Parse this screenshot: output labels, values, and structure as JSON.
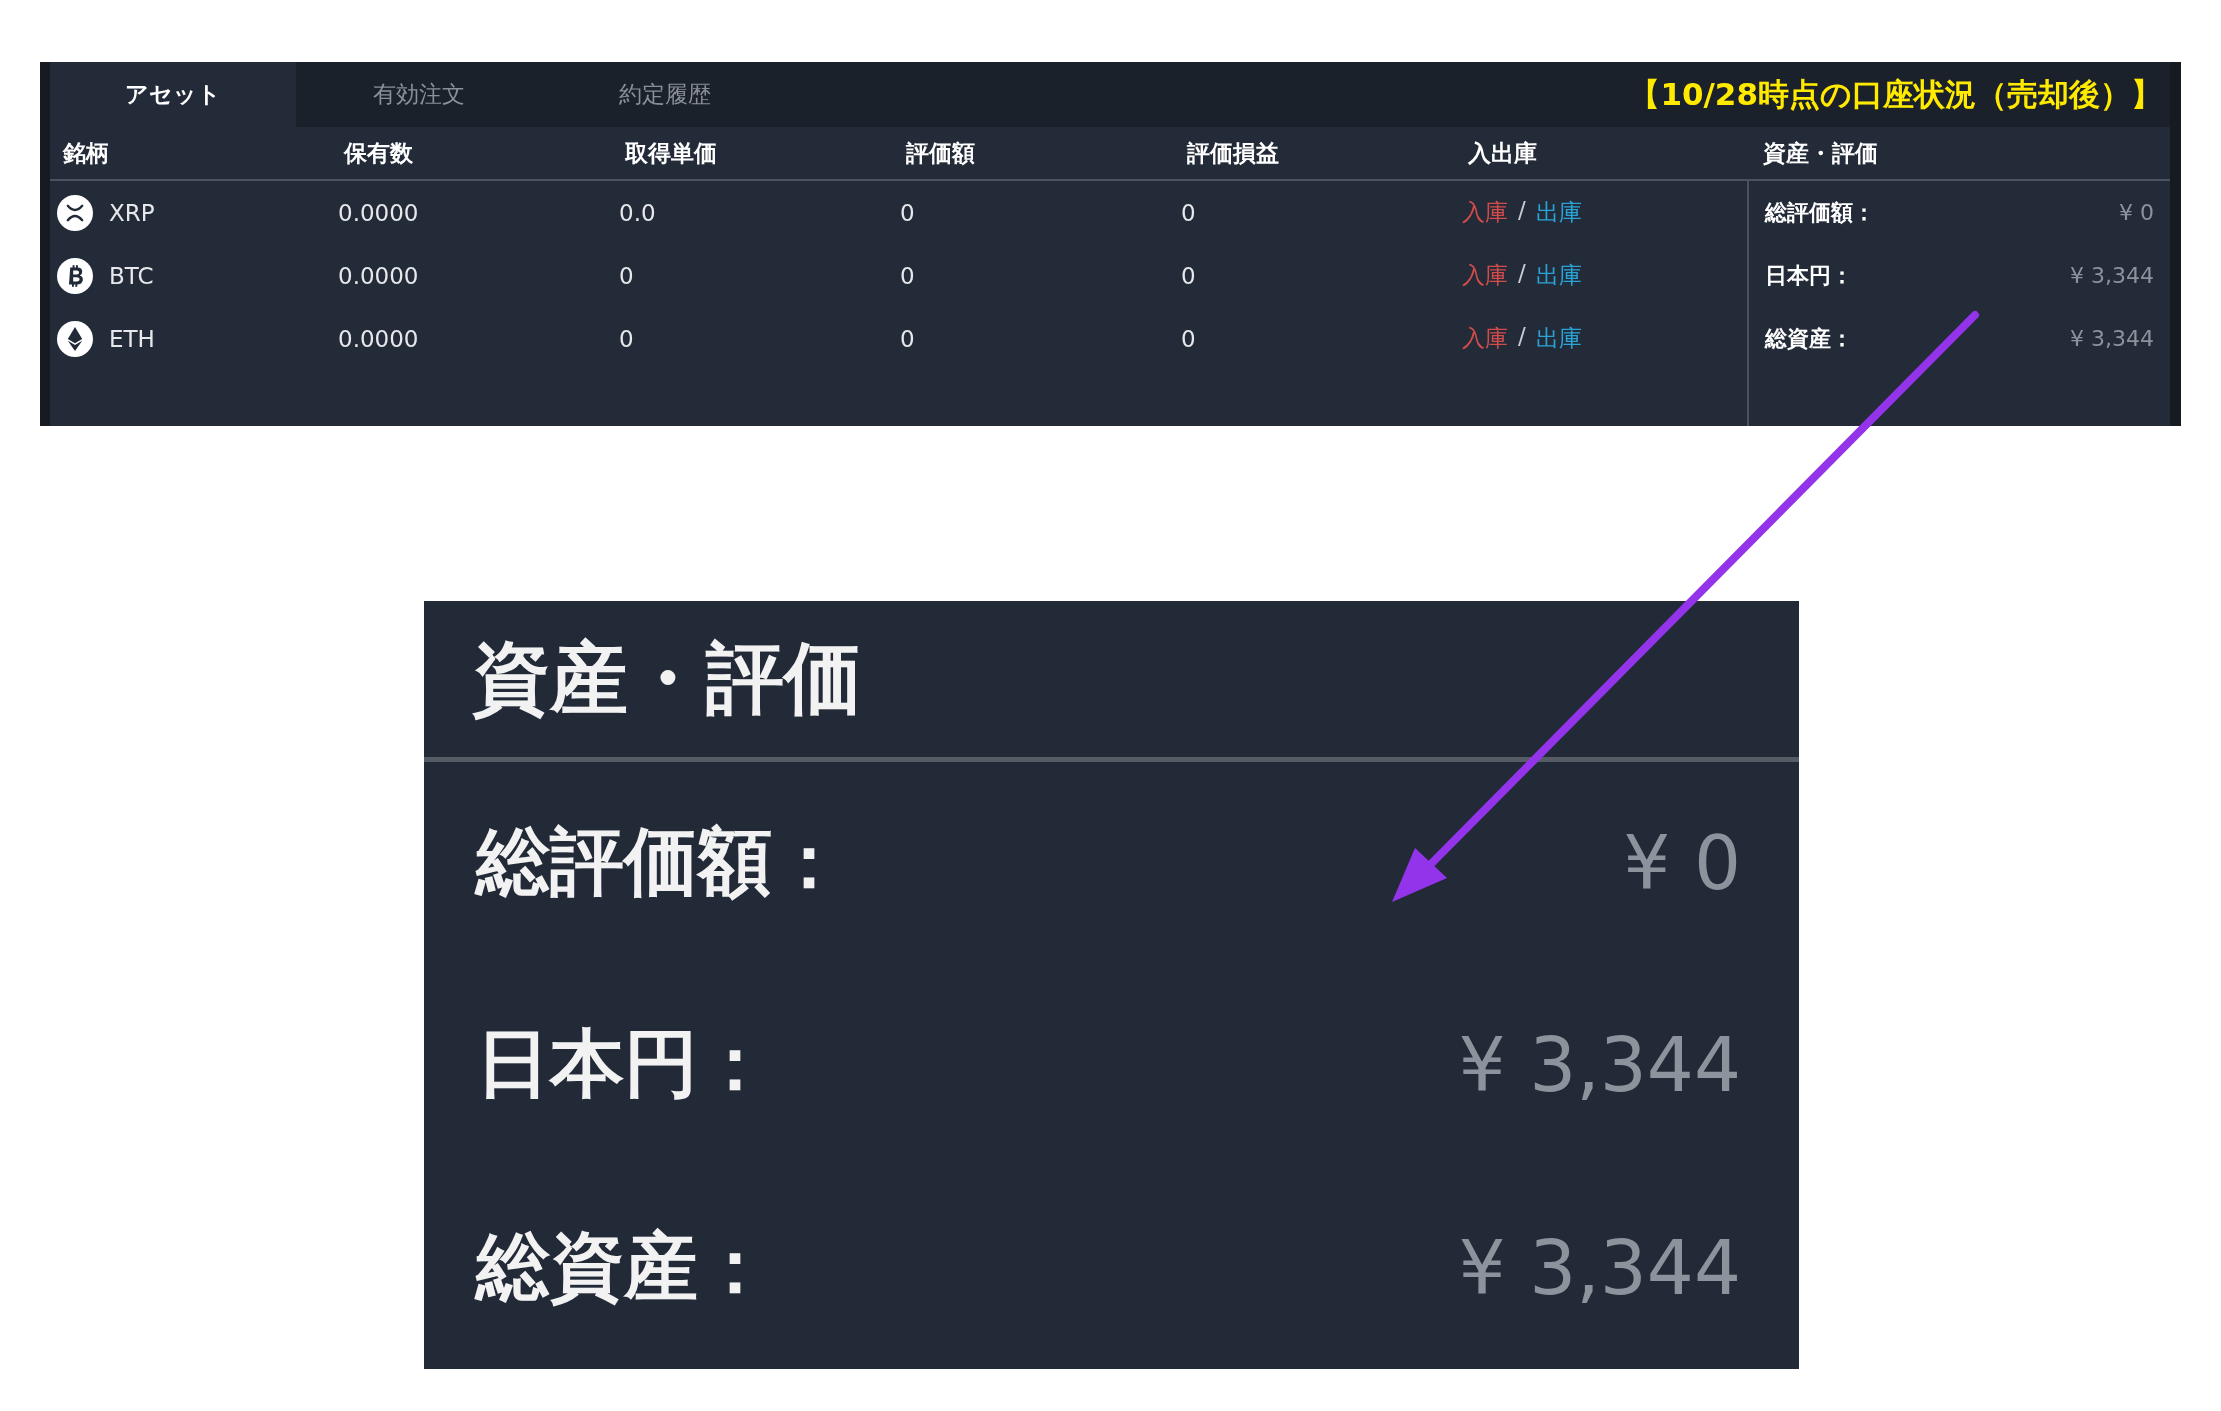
{
  "tabs": [
    {
      "label": "アセット",
      "selected": true
    },
    {
      "label": "有効注文",
      "selected": false
    },
    {
      "label": "約定履歴",
      "selected": false
    }
  ],
  "caption": "【10/28時点の口座状況（売却後）】",
  "table": {
    "columns": [
      "銘柄",
      "保有数",
      "取得単価",
      "評価額",
      "評価損益",
      "入出庫"
    ],
    "rows": [
      {
        "kind": "xrp",
        "coin": "XRP",
        "holding": "0.0000",
        "avg_price": "0.0",
        "valuation": "0",
        "pnl": "0",
        "deposit": "入庫",
        "separator": "/",
        "withdraw": "出庫"
      },
      {
        "kind": "btc",
        "coin": "BTC",
        "holding": "0.0000",
        "avg_price": "0",
        "valuation": "0",
        "pnl": "0",
        "deposit": "入庫",
        "separator": "/",
        "withdraw": "出庫"
      },
      {
        "kind": "eth",
        "coin": "ETH",
        "holding": "0.0000",
        "avg_price": "0",
        "valuation": "0",
        "pnl": "0",
        "deposit": "入庫",
        "separator": "/",
        "withdraw": "出庫"
      }
    ]
  },
  "summary": {
    "title": "資産・評価",
    "items": [
      {
        "label": "総評価額：",
        "value": "¥ 0"
      },
      {
        "label": "日本円：",
        "value": "¥ 3,344"
      },
      {
        "label": "総資産：",
        "value": "¥ 3,344"
      }
    ]
  },
  "zoom_inset": {
    "title": "資産・評価",
    "items": [
      {
        "label": "総評価額：",
        "value": "¥ 0"
      },
      {
        "label": "日本円：",
        "value": "¥ 3,344"
      },
      {
        "label": "総資産：",
        "value": "¥ 3,344"
      }
    ]
  }
}
